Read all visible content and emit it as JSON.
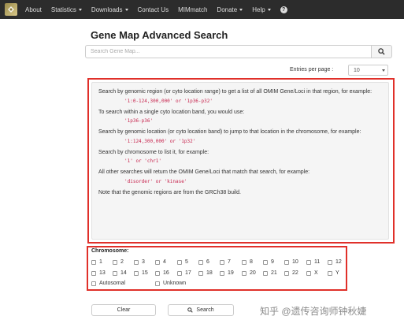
{
  "nav": {
    "logo_icon": "mim-logo-icon",
    "items": [
      {
        "label": "About",
        "dropdown": false
      },
      {
        "label": "Statistics",
        "dropdown": true
      },
      {
        "label": "Downloads",
        "dropdown": true
      },
      {
        "label": "Contact Us",
        "dropdown": false
      },
      {
        "label": "MIMmatch",
        "dropdown": false
      },
      {
        "label": "Donate",
        "dropdown": true
      },
      {
        "label": "Help",
        "dropdown": true
      }
    ],
    "help_icon": "?"
  },
  "page_title": "Gene Map Advanced Search",
  "search": {
    "placeholder": "Search Gene Map...",
    "icon": "search-icon"
  },
  "entries": {
    "label": "Entries per page :",
    "value": "10"
  },
  "help": {
    "p1": "Search by genomic region (or cyto location range) to get a list of all OMIM Gene/Loci in that region, for example:",
    "c1": "'1:0-124,300,000' or '1p36-p32'",
    "p2": "To search within a single cyto location band, you would use:",
    "c2": "'1p36-p36'",
    "p3": "Search by genomic location (or cyto location band) to jump to that location in the chromosome, for example:",
    "c3": "'1:124,300,000' or '1p32'",
    "p4": "Search by chromosome to list it, for example:",
    "c4": "'1' or 'chr1'",
    "p5": "All other searches will return the OMIM Gene/Loci that match that search, for example:",
    "c5": "'disorder' or 'kinase'",
    "p6": "Note that the genomic regions are from the GRCh38 build."
  },
  "chromosome": {
    "label": "Chromosome:",
    "row1": [
      "1",
      "2",
      "3",
      "4",
      "5",
      "6",
      "7",
      "8",
      "9",
      "10",
      "11",
      "12"
    ],
    "row2": [
      "13",
      "14",
      "15",
      "16",
      "17",
      "18",
      "19",
      "20",
      "21",
      "22",
      "X",
      "Y"
    ],
    "row3": [
      "Autosomal",
      "Unknown"
    ]
  },
  "buttons": {
    "clear": "Clear",
    "search": "Search"
  },
  "watermark": "知乎 @遗传咨询师钟秋婕",
  "colors": {
    "navbar": "#2c2c2c",
    "highlight": "#e0302a",
    "code": "#c7254e"
  }
}
